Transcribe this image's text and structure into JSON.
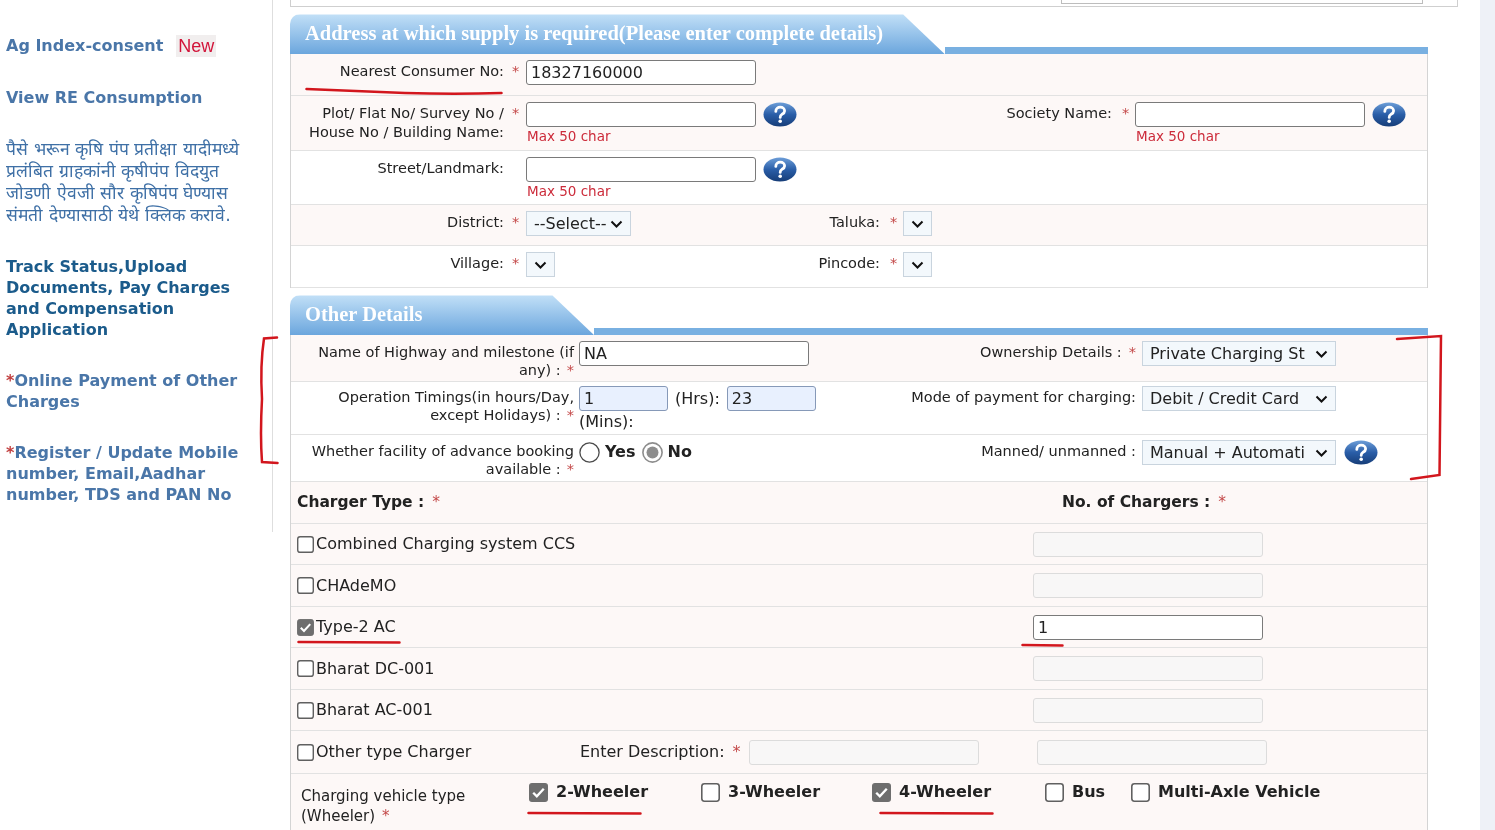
{
  "sidebar": {
    "items": [
      {
        "kind": "link",
        "label": "Ag Index-consent",
        "badge": "New",
        "visited": true
      },
      {
        "kind": "link",
        "label": "View RE Consumption",
        "visited": true
      },
      {
        "kind": "notice",
        "label": "पैसे भरून कृषि पंप प्रतीक्षा यादीमध्ये प्रलंबित ग्राहकांनी कृषीपंप विदयुत जोडणी ऐवजी सौर कृषिपंप घेण्यास संमती देण्यासाठी येथे क्लिक करावे."
      },
      {
        "kind": "link",
        "label": "Track Status,Upload Documents, Pay Charges and Compensation Application",
        "visited": false
      },
      {
        "kind": "link",
        "marker": "*",
        "label": "Online Payment of Other Charges",
        "visited": true
      },
      {
        "kind": "link",
        "marker": "*",
        "label": "Register / Update Mobile number, Email,Aadhar number, TDS and PAN No",
        "visited": true
      }
    ]
  },
  "address_section": {
    "title": "Address at which supply is required(Please enter complete details)",
    "rows": [
      {
        "fields": [
          {
            "kind": "text",
            "label": "Nearest Consumer No:",
            "required_mark": "*",
            "value": "18327160000",
            "help": false
          }
        ]
      },
      {
        "fields": [
          {
            "kind": "text",
            "label": "Plot/ Flat No/ Survey No / House No / Building Name:",
            "required_mark": "*",
            "help": true,
            "hint": "Max 50 char"
          },
          {
            "kind": "text",
            "label": "Society Name:",
            "required_mark": "*",
            "help": true,
            "hint": "Max 50 char"
          }
        ]
      },
      {
        "fields": [
          {
            "kind": "text",
            "label": "Street/Landmark:",
            "help": true,
            "hint": "Max 50 char"
          }
        ]
      },
      {
        "fields": [
          {
            "kind": "select",
            "label": "District:",
            "required_mark": "*",
            "value": "--Select--"
          },
          {
            "kind": "select",
            "label": "Taluka:",
            "required_mark": "*"
          }
        ]
      },
      {
        "fields": [
          {
            "kind": "select",
            "label": "Village:",
            "required_mark": "*"
          },
          {
            "kind": "select",
            "label": "Pincode:",
            "required_mark": "*"
          }
        ]
      }
    ]
  },
  "other_details": {
    "title": "Other Details",
    "rows": [
      {
        "fields": [
          {
            "kind": "text",
            "label": "Name of Highway and milestone (if any) :",
            "required_mark": "*",
            "value": "NA",
            "help": false
          },
          {
            "kind": "select",
            "label": "Ownership Details :",
            "required_mark": "*",
            "value": "Private Charging St",
            "help": false
          }
        ]
      },
      {
        "fields": [
          {
            "kind": "timing",
            "label": "Operation Timings(in hours/Day, except Holidays) :",
            "required_mark": "*",
            "hours": "1",
            "hours_label": "(Hrs):",
            "minutes": "23",
            "minutes_label": "(Mins):"
          },
          {
            "kind": "select",
            "label": "Mode of payment for charging:",
            "value": "Debit / Credit Card",
            "help": false
          }
        ]
      },
      {
        "fields": [
          {
            "kind": "radio",
            "label": "Whether facility of advance booking available :",
            "required_mark": "*",
            "options": [
              {
                "label": "Yes",
                "selected": false
              },
              {
                "label": "No",
                "selected": true
              }
            ]
          },
          {
            "kind": "select",
            "label": "Manned/ unmanned :",
            "value": "Manual + Automati",
            "help": true
          }
        ]
      }
    ]
  },
  "chargers": {
    "type_label": "Charger Type :",
    "type_mark": "*",
    "count_label": "No. of Chargers :",
    "count_mark": "*",
    "rows": [
      {
        "kind": "charger",
        "label": "Combined Charging system CCS",
        "checked": false
      },
      {
        "kind": "charger",
        "label": "CHAdeMO",
        "checked": false
      },
      {
        "kind": "charger",
        "label": "Type-2 AC",
        "checked": true,
        "count": "1"
      },
      {
        "kind": "charger",
        "label": "Bharat DC-001",
        "checked": false
      },
      {
        "kind": "charger",
        "label": "Bharat AC-001",
        "checked": false
      },
      {
        "kind": "other",
        "label": "Other type Charger",
        "checked": false,
        "description_label": "Enter Description:",
        "description_mark": "*"
      }
    ]
  },
  "vehicle_types": {
    "label": "Charging vehicle type (Wheeler)",
    "required_mark": "*",
    "options": [
      {
        "label": "2-Wheeler",
        "checked": true
      },
      {
        "label": "3-Wheeler",
        "checked": false
      },
      {
        "label": "4-Wheeler",
        "checked": true
      },
      {
        "label": "Bus",
        "checked": false
      },
      {
        "label": "Multi-Axle Vehicle",
        "checked": false
      }
    ]
  }
}
